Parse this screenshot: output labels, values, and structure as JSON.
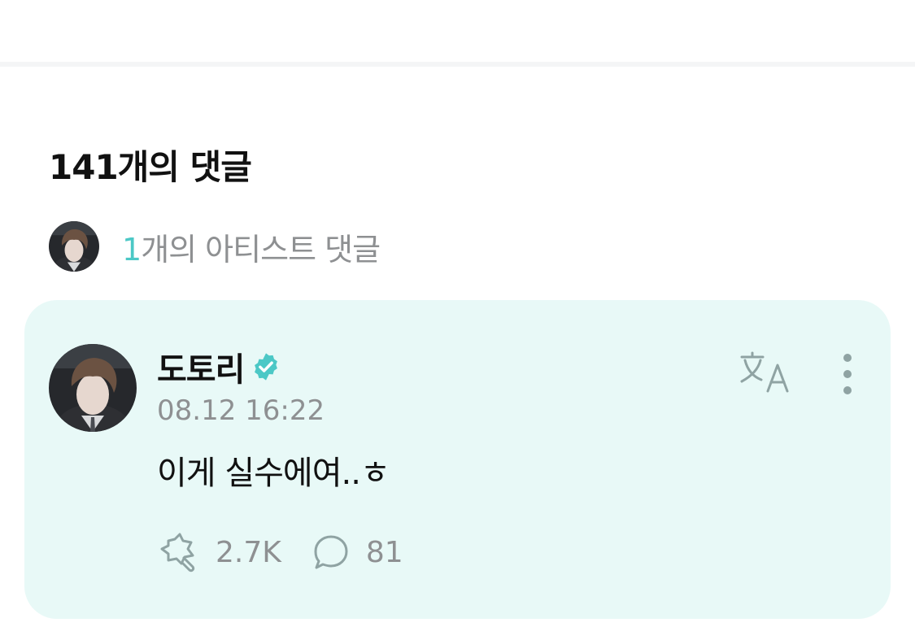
{
  "comments_header": {
    "title": "141개의 댓글"
  },
  "artist_comments": {
    "count": "1",
    "label": "개의 아티스트 댓글"
  },
  "comment": {
    "author": "도토리",
    "verified": true,
    "timestamp": "08.12 16:22",
    "body": "이게 실수에여..ㅎ",
    "like_count": "2.7K",
    "reply_count": "81"
  },
  "icons": {
    "verified": "verified-badge-icon",
    "translate": "translate-icon",
    "more": "more-vertical-icon",
    "like": "cheer-icon",
    "reply": "speech-bubble-icon"
  },
  "colors": {
    "accent": "#4cc8c6",
    "card_background": "#e8f9f7",
    "muted_text": "#8e9092",
    "primary_text": "#111111"
  }
}
